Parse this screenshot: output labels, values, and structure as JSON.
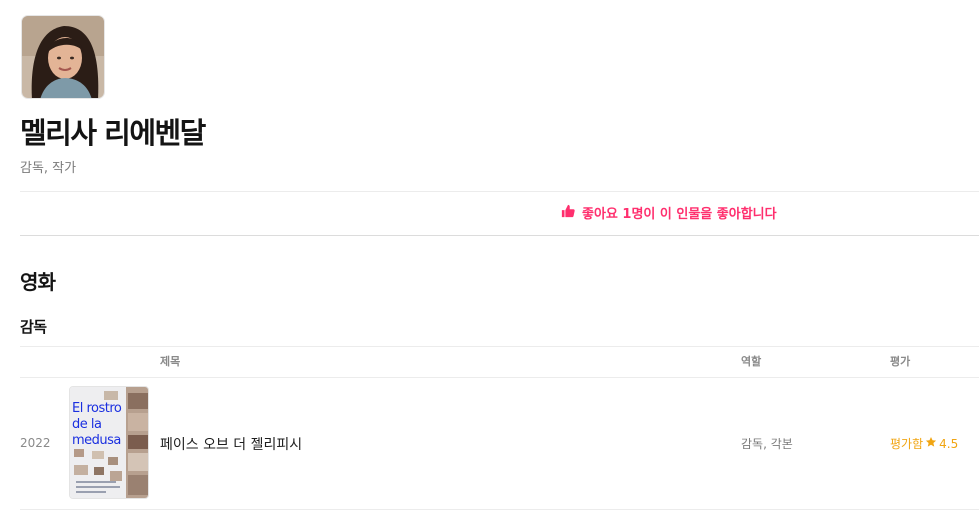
{
  "person": {
    "name": "멜리사 리에벤달",
    "roles": "감독, 작가"
  },
  "like": {
    "text": "좋아요 1명이 이 인물을 좋아합니다",
    "icon": "thumbs-up-icon",
    "color": "#ff2f6e"
  },
  "section": {
    "title": "영화",
    "subsection": "감독"
  },
  "table": {
    "headers": {
      "title": "제목",
      "role": "역할",
      "rating": "평가"
    },
    "rows": [
      {
        "year": "2022",
        "poster_text": [
          "El rostro",
          "de la",
          "medusa"
        ],
        "title": "페이스 오브 더 젤리피시",
        "role": "감독, 각본",
        "rating_label": "평가함",
        "rating_icon": "star-icon",
        "rating_value": "4.5"
      }
    ]
  },
  "colors": {
    "accent": "#ff2f6e",
    "rating": "#f1a512"
  }
}
